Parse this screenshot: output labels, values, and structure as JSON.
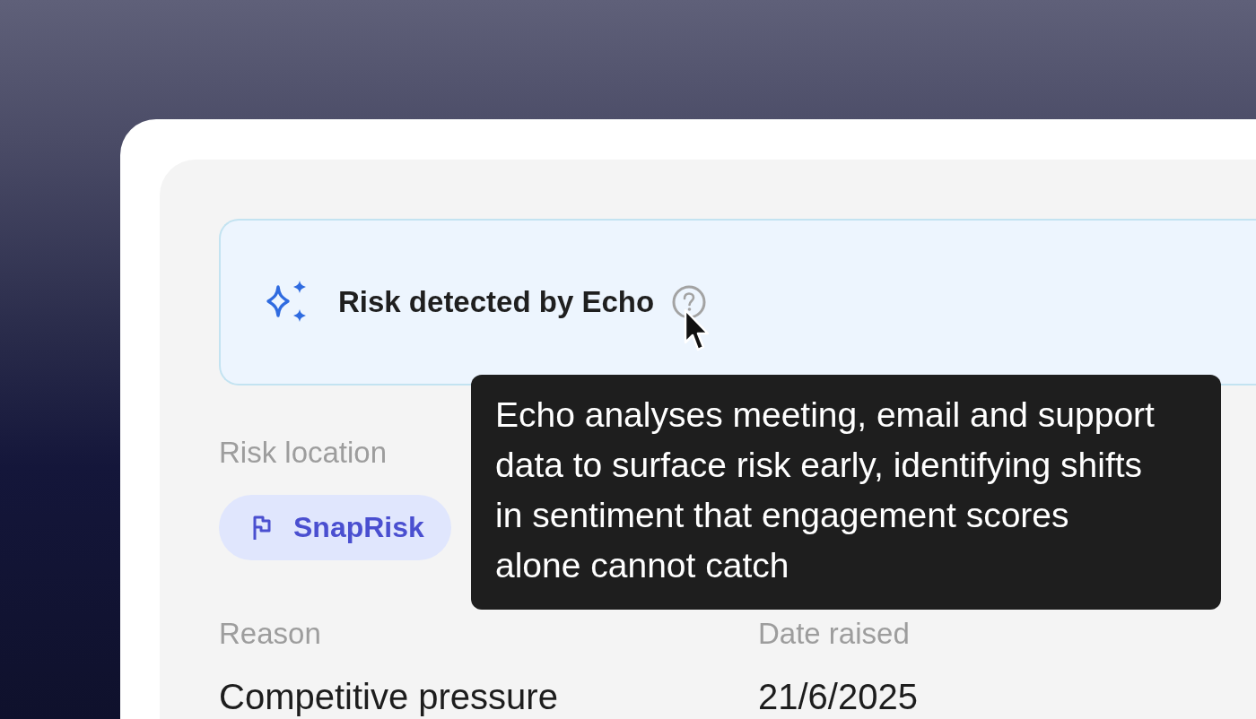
{
  "banner": {
    "title": "Risk detected by Echo"
  },
  "tooltip": {
    "text": "Echo analyses meeting, email and support data to surface risk early, identifying shifts in sentiment that engagement scores alone cannot catch"
  },
  "risk_location": {
    "label": "Risk location",
    "tag": "SnapRisk"
  },
  "details": [
    {
      "label": "Reason",
      "value": "Competitive pressure"
    },
    {
      "label": "Date raised",
      "value": "21/6/2025"
    }
  ]
}
